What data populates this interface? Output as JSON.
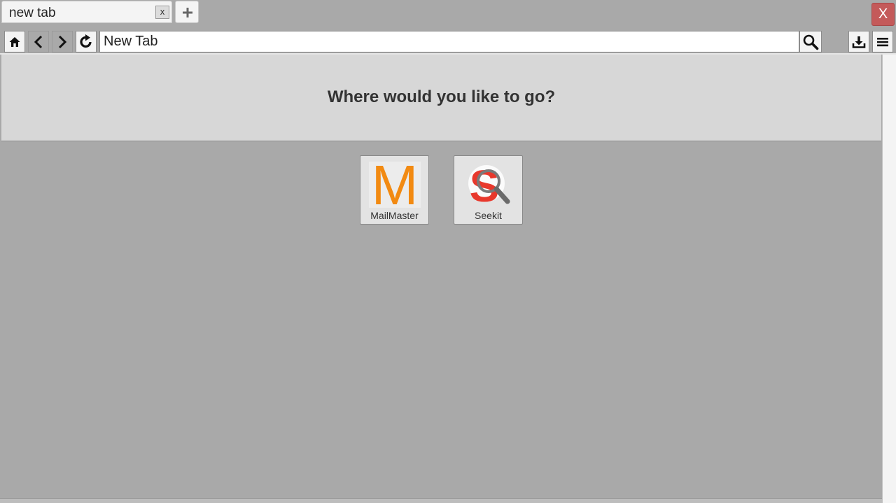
{
  "tabs": [
    {
      "title": "new tab",
      "close_label": "x"
    }
  ],
  "window": {
    "close_label": "X"
  },
  "toolbar": {
    "address_value": "New Tab"
  },
  "page": {
    "heading": "Where would you like to go?",
    "tiles": [
      {
        "label": "MailMaster",
        "logo_letter": "M",
        "icon": "mailmaster-logo"
      },
      {
        "label": "Seekit",
        "logo_letter": "S",
        "icon": "seekit-logo"
      }
    ]
  },
  "colors": {
    "mailmaster_orange": "#f28a12",
    "seekit_red": "#e8382c",
    "close_red": "#c45a5a"
  },
  "icons": [
    "home-icon",
    "back-icon",
    "forward-icon",
    "reload-icon",
    "search-icon",
    "download-icon",
    "menu-icon",
    "plus-icon"
  ]
}
